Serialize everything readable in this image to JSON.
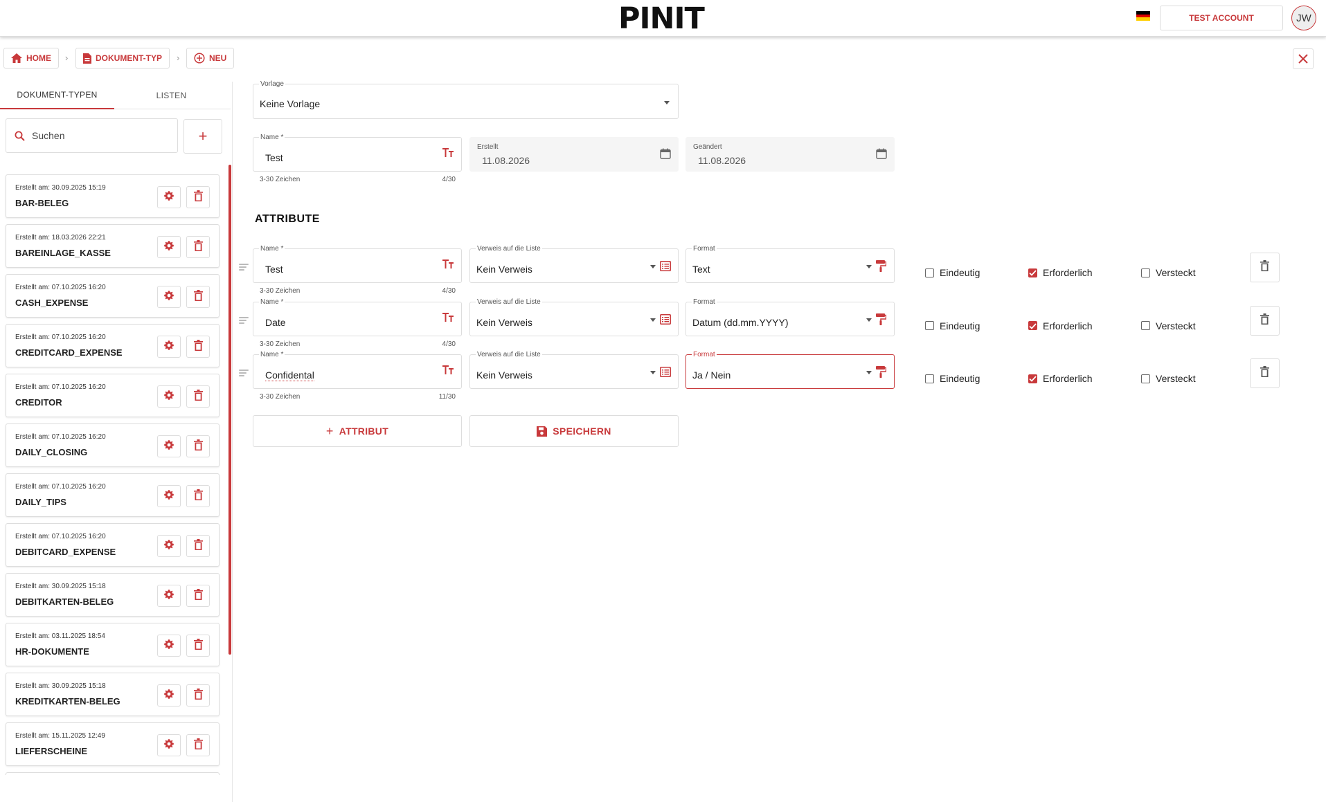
{
  "header": {
    "logo": "PINIT",
    "account_label": "TEST ACCOUNT",
    "avatar_initials": "JW",
    "flag_colors": [
      "#000000",
      "#dd0000",
      "#ffce00"
    ]
  },
  "breadcrumb": [
    {
      "label": "HOME",
      "icon": "home-icon"
    },
    {
      "label": "DOKUMENT-TYP",
      "icon": "document-icon"
    },
    {
      "label": "NEU",
      "icon": "add-circle-icon"
    }
  ],
  "sidebar": {
    "tabs": [
      "DOKUMENT-TYPEN",
      "LISTEN"
    ],
    "search_placeholder": "Suchen",
    "items": [
      {
        "date": "Erstellt am: 30.09.2025 15:19",
        "name": "BAR-BELEG"
      },
      {
        "date": "Erstellt am: 18.03.2026 22:21",
        "name": "BAREINLAGE_KASSE"
      },
      {
        "date": "Erstellt am: 07.10.2025 16:20",
        "name": "CASH_EXPENSE"
      },
      {
        "date": "Erstellt am: 07.10.2025 16:20",
        "name": "CREDITCARD_EXPENSE"
      },
      {
        "date": "Erstellt am: 07.10.2025 16:20",
        "name": "CREDITOR"
      },
      {
        "date": "Erstellt am: 07.10.2025 16:20",
        "name": "DAILY_CLOSING"
      },
      {
        "date": "Erstellt am: 07.10.2025 16:20",
        "name": "DAILY_TIPS"
      },
      {
        "date": "Erstellt am: 07.10.2025 16:20",
        "name": "DEBITCARD_EXPENSE"
      },
      {
        "date": "Erstellt am: 30.09.2025 15:18",
        "name": "DEBITKARTEN-BELEG"
      },
      {
        "date": "Erstellt am: 03.11.2025 18:54",
        "name": "HR-DOKUMENTE"
      },
      {
        "date": "Erstellt am: 30.09.2025 15:18",
        "name": "KREDITKARTEN-BELEG"
      },
      {
        "date": "Erstellt am: 15.11.2025 12:49",
        "name": "LIEFERSCHEINE"
      }
    ]
  },
  "form": {
    "template": {
      "label": "Vorlage",
      "value": "Keine Vorlage"
    },
    "name": {
      "label": "Name *",
      "value": "Test",
      "hint": "3-30 Zeichen",
      "counter": "4/30"
    },
    "created": {
      "label": "Erstellt",
      "value": "11.08.2026"
    },
    "changed": {
      "label": "Geändert",
      "value": "11.08.2026"
    }
  },
  "attributes": {
    "title": "ATTRIBUTE",
    "name_label": "Name *",
    "list_label": "Verweis auf die Liste",
    "format_label": "Format",
    "hint": "3-30 Zeichen",
    "checkbox_labels": [
      "Eindeutig",
      "Erforderlich",
      "Versteckt"
    ],
    "rows": [
      {
        "name": "Test",
        "counter": "4/30",
        "list": "Kein Verweis",
        "format": "Text",
        "unique": false,
        "required": true,
        "hidden": false
      },
      {
        "name": "Date",
        "counter": "4/30",
        "list": "Kein Verweis",
        "format": "Datum (dd.mm.YYYY)",
        "unique": false,
        "required": true,
        "hidden": false
      },
      {
        "name": "Confidental",
        "counter": "11/30",
        "list": "Kein Verweis",
        "format": "Ja / Nein",
        "unique": false,
        "required": true,
        "hidden": false
      }
    ]
  },
  "actions": {
    "add_attribute": "ATTRIBUT",
    "save": "SPEICHERN"
  },
  "colors": {
    "accent": "#c8393b",
    "border": "#dddddd"
  }
}
